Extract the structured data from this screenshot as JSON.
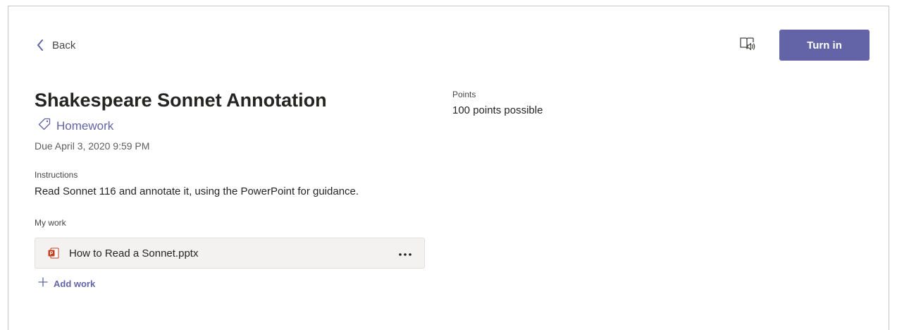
{
  "header": {
    "back_label": "Back",
    "turn_in_label": "Turn in",
    "immersive_reader_icon": "immersive-reader-icon"
  },
  "assignment": {
    "title": "Shakespeare Sonnet Annotation",
    "category": "Homework",
    "due": "Due April 3, 2020 9:59 PM"
  },
  "instructions": {
    "label": "Instructions",
    "text": "Read Sonnet 116 and annotate it, using the PowerPoint for guidance."
  },
  "my_work": {
    "label": "My work",
    "files": [
      {
        "name": "How to Read a Sonnet.pptx",
        "icon": "powerpoint-file-icon"
      }
    ],
    "add_label": "Add work"
  },
  "points": {
    "label": "Points",
    "value": "100 points possible"
  },
  "colors": {
    "accent": "#6264a7",
    "text": "#252423",
    "secondary_text": "#605e5c",
    "card_bg": "#f3f2f1",
    "powerpoint": "#c43e1c"
  }
}
